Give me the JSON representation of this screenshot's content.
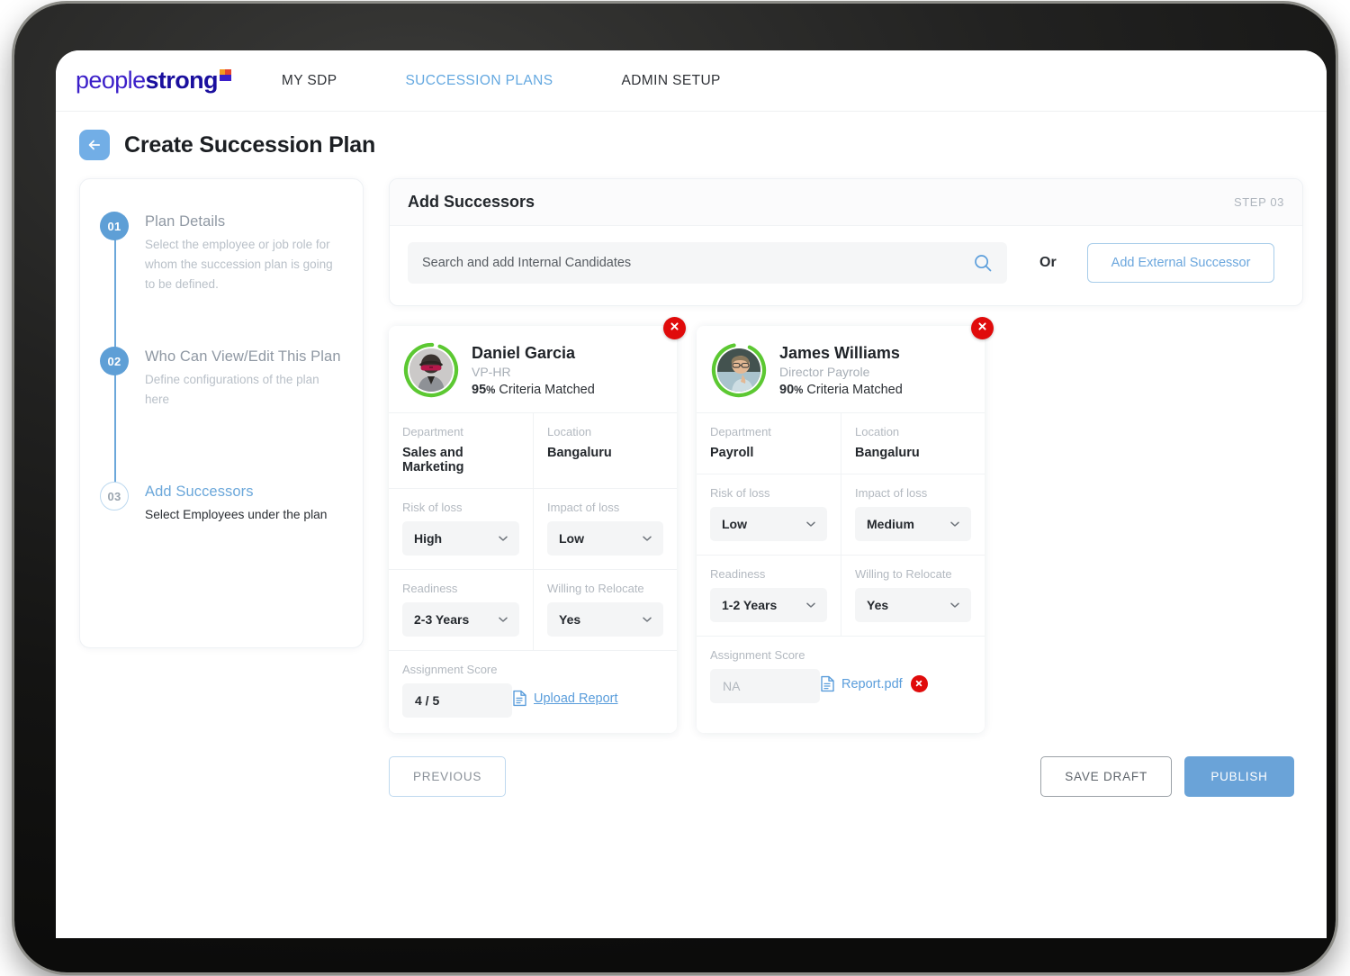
{
  "brand": {
    "logo_people": "people",
    "logo_strong": "strong",
    "accent_blue": "#6aa3d8",
    "link_blue": "#5a9ddb",
    "ring_green": "#5cc832",
    "danger_red": "#e00b0b",
    "logo_purple": "#3b1fc9"
  },
  "topnav": {
    "items": [
      {
        "label": "MY SDP",
        "active": false
      },
      {
        "label": "SUCCESSION PLANS",
        "active": true
      },
      {
        "label": "ADMIN SETUP",
        "active": false
      }
    ]
  },
  "page": {
    "title": "Create Succession Plan",
    "back_icon": "arrow-left-icon"
  },
  "stepper": {
    "steps": [
      {
        "number": "01",
        "title": "Plan Details",
        "desc": "Select the employee or job role for whom the succession plan is going to be defined.",
        "state": "done"
      },
      {
        "number": "02",
        "title": "Who Can View/Edit This Plan",
        "desc": "Define configurations of the plan here",
        "state": "done"
      },
      {
        "number": "03",
        "title": "Add Successors",
        "desc": "Select Employees under the plan",
        "state": "current"
      }
    ]
  },
  "add_successors": {
    "title": "Add Successors",
    "step_label": "STEP 03",
    "search_placeholder": "Search and add Internal Candidates",
    "search_value": "",
    "search_icon": "search-icon",
    "or_label": "Or",
    "external_button": "Add External Successor"
  },
  "successors": [
    {
      "name": "Daniel Garcia",
      "role": "VP-HR",
      "match_percent": "95",
      "match_suffix": "%",
      "match_label": "Criteria Matched",
      "remove_icon": "close-icon",
      "fields": {
        "department_label": "Department",
        "department_value": "Sales and Marketing",
        "location_label": "Location",
        "location_value": "Bangaluru",
        "risk_label": "Risk of loss",
        "risk_value": "High",
        "impact_label": "Impact of loss",
        "impact_value": "Low",
        "readiness_label": "Readiness",
        "readiness_value": "2-3 Years",
        "relocate_label": "Willing to Relocate",
        "relocate_value": "Yes",
        "assignment_label": "Assignment Score",
        "assignment_value": "4 / 5",
        "report_action": "Upload Report"
      }
    },
    {
      "name": "James Williams",
      "role": "Director Payrole",
      "match_percent": "90",
      "match_suffix": "%",
      "match_label": "Criteria Matched",
      "remove_icon": "close-icon",
      "fields": {
        "department_label": "Department",
        "department_value": "Payroll",
        "location_label": "Location",
        "location_value": "Bangaluru",
        "risk_label": "Risk of loss",
        "risk_value": "Low",
        "impact_label": "Impact of loss",
        "impact_value": "Medium",
        "readiness_label": "Readiness",
        "readiness_value": "1-2 Years",
        "relocate_label": "Willing to Relocate",
        "relocate_value": "Yes",
        "assignment_label": "Assignment Score",
        "assignment_value": "NA",
        "report_action": "Report.pdf"
      }
    }
  ],
  "actions": {
    "previous": "PREVIOUS",
    "save_draft": "SAVE DRAFT",
    "publish": "PUBLISH"
  }
}
